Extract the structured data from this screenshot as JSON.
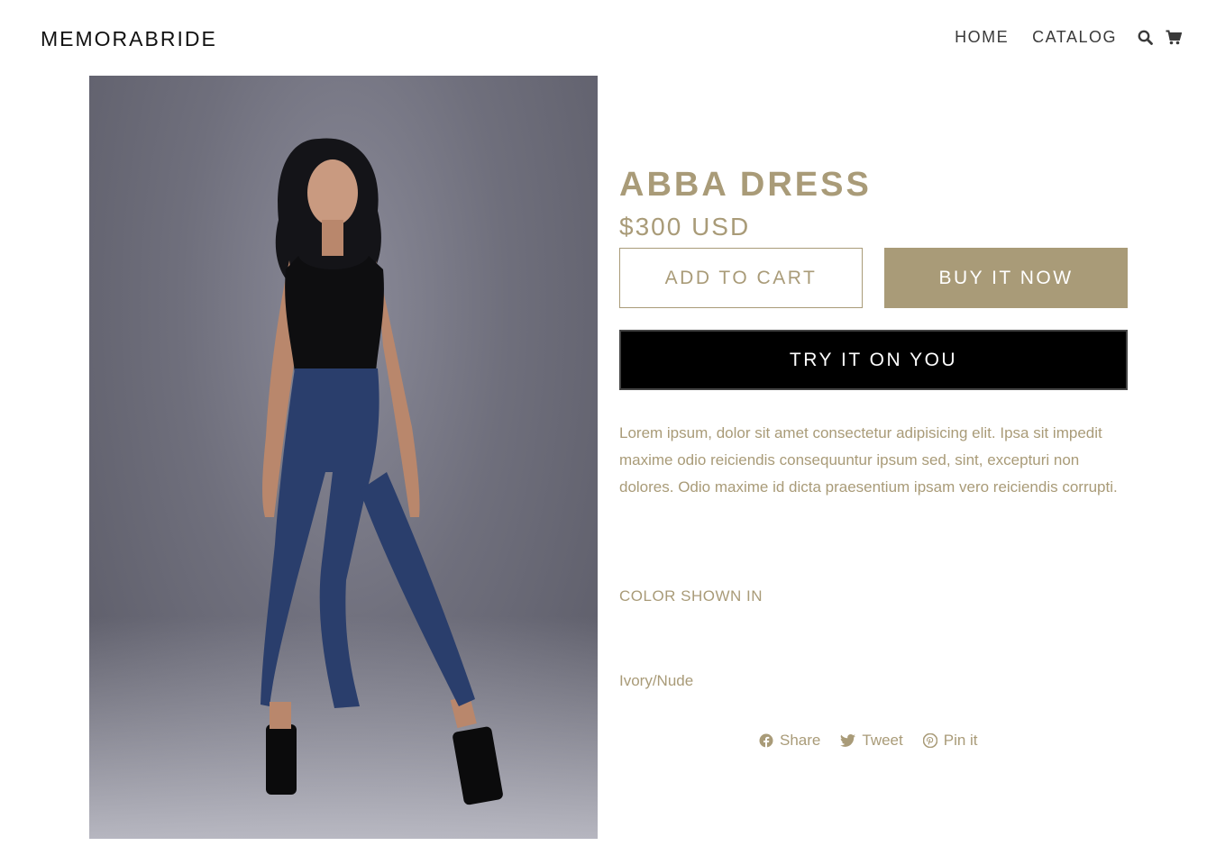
{
  "header": {
    "logo": "MEMORABRIDE",
    "nav": [
      {
        "label": "HOME"
      },
      {
        "label": "CATALOG"
      }
    ],
    "icons": [
      "search-icon",
      "cart-icon"
    ]
  },
  "product": {
    "title": "ABBA DRESS",
    "price": "$300 USD",
    "add_to_cart": "ADD TO CART",
    "buy_now": "BUY IT NOW",
    "try_on": "TRY IT ON YOU",
    "description": "Lorem ipsum, dolor sit amet consectetur adipisicing elit. Ipsa sit impedit maxime odio reiciendis consequuntur ipsum sed, sint, excepturi non dolores. Odio maxime id dicta praesentium ipsam vero reiciendis corrupti.",
    "color_label": "COLOR SHOWN IN",
    "color_value": "Ivory/Nude"
  },
  "social": {
    "share": "Share",
    "tweet": "Tweet",
    "pin": "Pin it"
  },
  "colors": {
    "accent": "#a99b78",
    "dark_button": "#000000",
    "text_dark": "#3a3a3a"
  }
}
